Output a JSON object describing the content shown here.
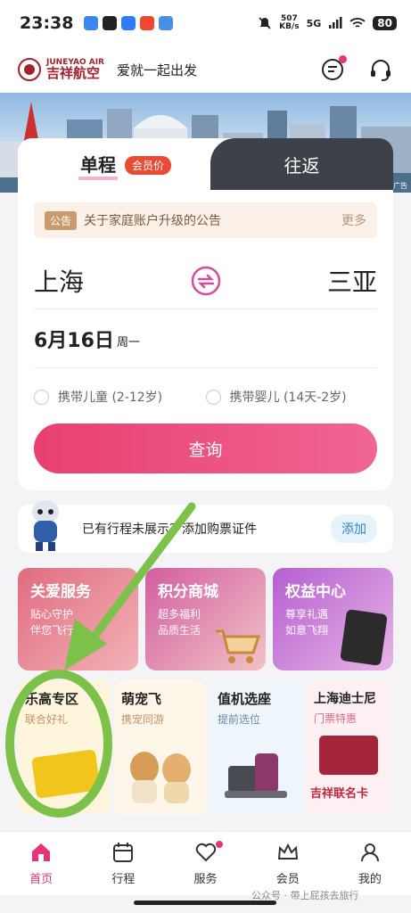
{
  "status": {
    "time": "23:38",
    "net_speed": "507",
    "net_unit": "KB/s",
    "signal": "5G",
    "battery": "80"
  },
  "header": {
    "logo_en": "JUNEYAO AIR",
    "logo_cn": "吉祥航空",
    "slogan": "爱就一起出发"
  },
  "banner": {
    "ad_label": "广告"
  },
  "booking": {
    "tab_one_way": "单程",
    "member_badge": "会员价",
    "tab_round_trip": "往返",
    "notice_tag": "公告",
    "notice_text": "关于家庭账户升级的公告",
    "notice_more": "更多",
    "from_city": "上海",
    "to_city": "三亚",
    "date": "6月16日",
    "weekday": "周一",
    "child_option": "携带儿童 (2-12岁)",
    "infant_option": "携带婴儿 (14天-2岁)",
    "search_label": "查询"
  },
  "trip_prompt": {
    "text": "已有行程未展示？添加购票证件",
    "add_label": "添加"
  },
  "services": [
    {
      "title": "关爱服务",
      "line1": "贴心守护",
      "line2": "伴您飞行"
    },
    {
      "title": "积分商城",
      "line1": "超多福利",
      "line2": "品质生活"
    },
    {
      "title": "权益中心",
      "line1": "尊享礼遇",
      "line2": "如意飞翔"
    }
  ],
  "tiles": [
    {
      "title": "乐高专区",
      "subtitle": "联合好礼"
    },
    {
      "title": "萌宠飞",
      "subtitle": "携宠同游"
    },
    {
      "title": "值机选座",
      "subtitle": "提前选位"
    },
    {
      "title": "上海迪士尼",
      "subtitle": "门票特惠",
      "card_text": "吉祥联名卡"
    }
  ],
  "nav": [
    {
      "label": "首页"
    },
    {
      "label": "行程"
    },
    {
      "label": "服务"
    },
    {
      "label": "会员"
    },
    {
      "label": "我的"
    }
  ],
  "watermark": "公众号 · 带上屁孩去旅行",
  "colors": {
    "accent": "#e5347a",
    "annotation": "#7cc24a"
  }
}
